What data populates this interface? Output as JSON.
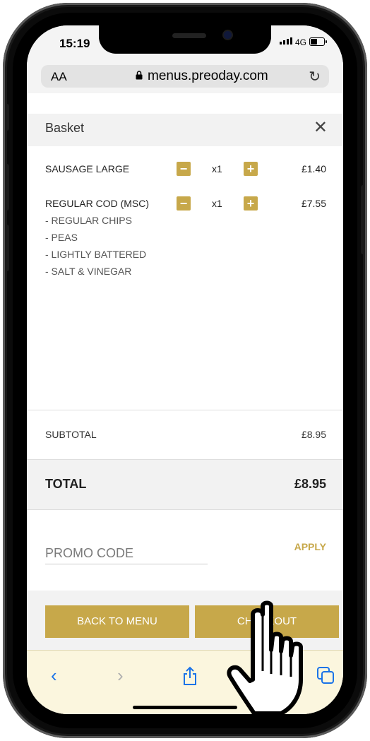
{
  "status": {
    "time": "15:19",
    "network": "4G"
  },
  "browser": {
    "text_size": "AA",
    "url": "menus.preoday.com"
  },
  "basket": {
    "title": "Basket",
    "items": [
      {
        "name": "SAUSAGE LARGE",
        "qty": "x1",
        "price": "£1.40",
        "options": []
      },
      {
        "name": "REGULAR COD (MSC)",
        "qty": "x1",
        "price": "£7.55",
        "options": [
          "- REGULAR CHIPS",
          "- PEAS",
          "- LIGHTLY BATTERED",
          "- SALT & VINEGAR"
        ]
      }
    ],
    "subtotal_label": "SUBTOTAL",
    "subtotal": "£8.95",
    "total_label": "TOTAL",
    "total": "£8.95",
    "promo_placeholder": "PROMO CODE",
    "apply_label": "APPLY",
    "back_label": "BACK TO MENU",
    "checkout_label": "CHECKOUT"
  },
  "colors": {
    "accent": "#c7a84a",
    "safari_toolbar": "#fbf6de",
    "link": "#1a73e8"
  }
}
